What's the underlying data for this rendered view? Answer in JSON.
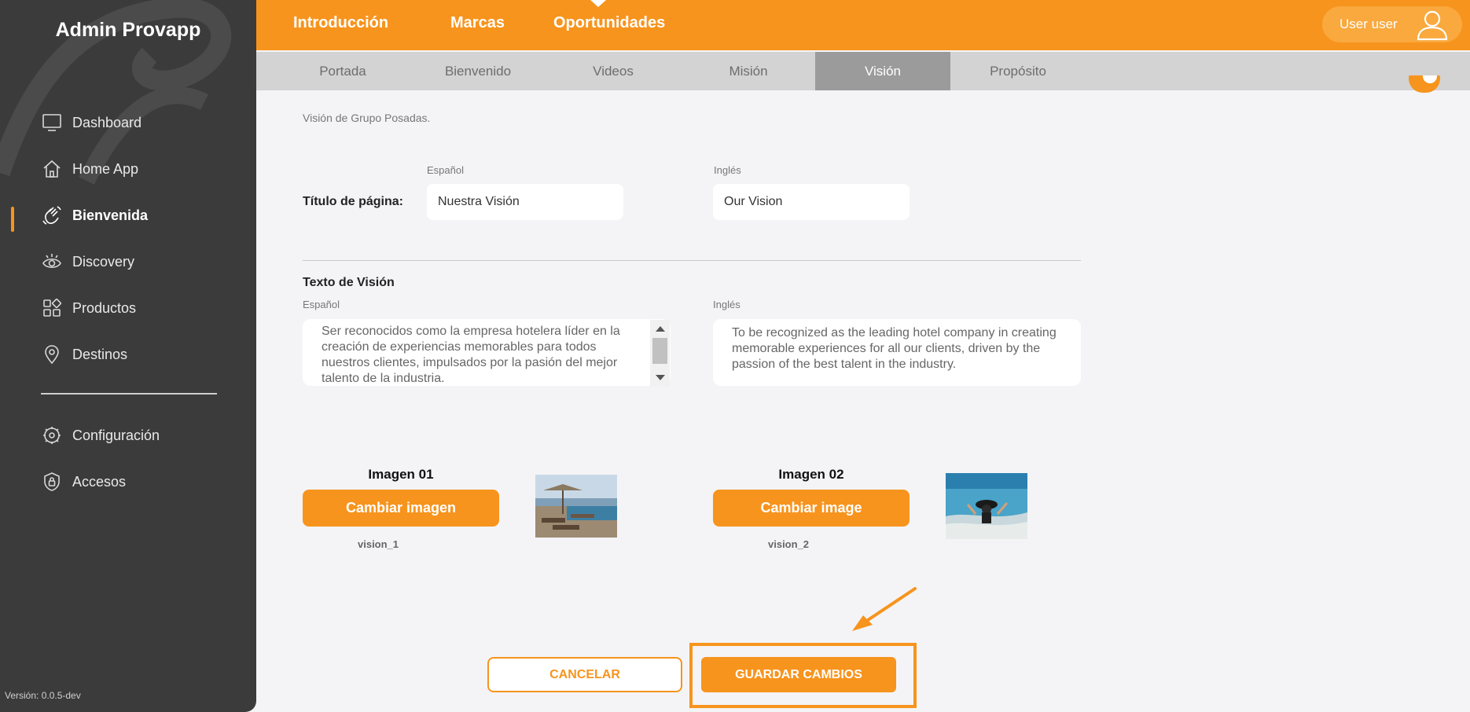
{
  "app": {
    "title": "Admin Provapp",
    "version": "Versión: 0.0.5-dev"
  },
  "sidebar": {
    "items": [
      {
        "label": "Dashboard",
        "icon": "monitor-icon"
      },
      {
        "label": "Home App",
        "icon": "home-icon"
      },
      {
        "label": "Bienvenida",
        "icon": "wave-hand-icon",
        "active": true
      },
      {
        "label": "Discovery",
        "icon": "eye-icon"
      },
      {
        "label": "Productos",
        "icon": "grid-icon"
      },
      {
        "label": "Destinos",
        "icon": "location-pin-icon"
      },
      {
        "label": "Configuración",
        "icon": "gear-icon"
      },
      {
        "label": "Accesos",
        "icon": "shield-lock-icon"
      }
    ]
  },
  "topbar": {
    "tabs": [
      {
        "label": "Introducción",
        "active": true
      },
      {
        "label": "Marcas"
      },
      {
        "label": "Oportunidades"
      }
    ],
    "user": {
      "label": "User user",
      "icon": "user-icon"
    }
  },
  "subtabs": [
    {
      "label": "Portada"
    },
    {
      "label": "Bienvenido"
    },
    {
      "label": "Videos"
    },
    {
      "label": "Misión"
    },
    {
      "label": "Visión",
      "active": true
    },
    {
      "label": "Propósito"
    }
  ],
  "main": {
    "description": "Visión de Grupo Posadas.",
    "page_title": {
      "label": "Título de página:",
      "es_label": "Español",
      "en_label": "Inglés",
      "es_value": "Nuestra Visión",
      "en_value": "Our Vision"
    },
    "vision_text": {
      "label": "Texto de Visión",
      "es_label": "Español",
      "en_label": "Inglés",
      "es_value": "Ser reconocidos como la empresa hotelera líder en la creación de experiencias memorables para todos nuestros clientes, impulsados por la pasión del mejor talento de la industria.",
      "en_value": "To be recognized as the leading hotel company in creating memorable experiences for all our clients, driven by the passion of the best talent in the industry."
    },
    "images": [
      {
        "title": "Imagen 01",
        "button": "Cambiar imagen",
        "file": "vision_1"
      },
      {
        "title": "Imagen 02",
        "button": "Cambiar image",
        "file": "vision_2"
      }
    ],
    "actions": {
      "cancel": "CANCELAR",
      "save": "GUARDAR CAMBIOS"
    }
  },
  "colors": {
    "accent": "#f7941d",
    "sidebar": "#3b3b3b",
    "subtabs": "#d3d3d3",
    "subtab_active": "#9b9b9b"
  }
}
